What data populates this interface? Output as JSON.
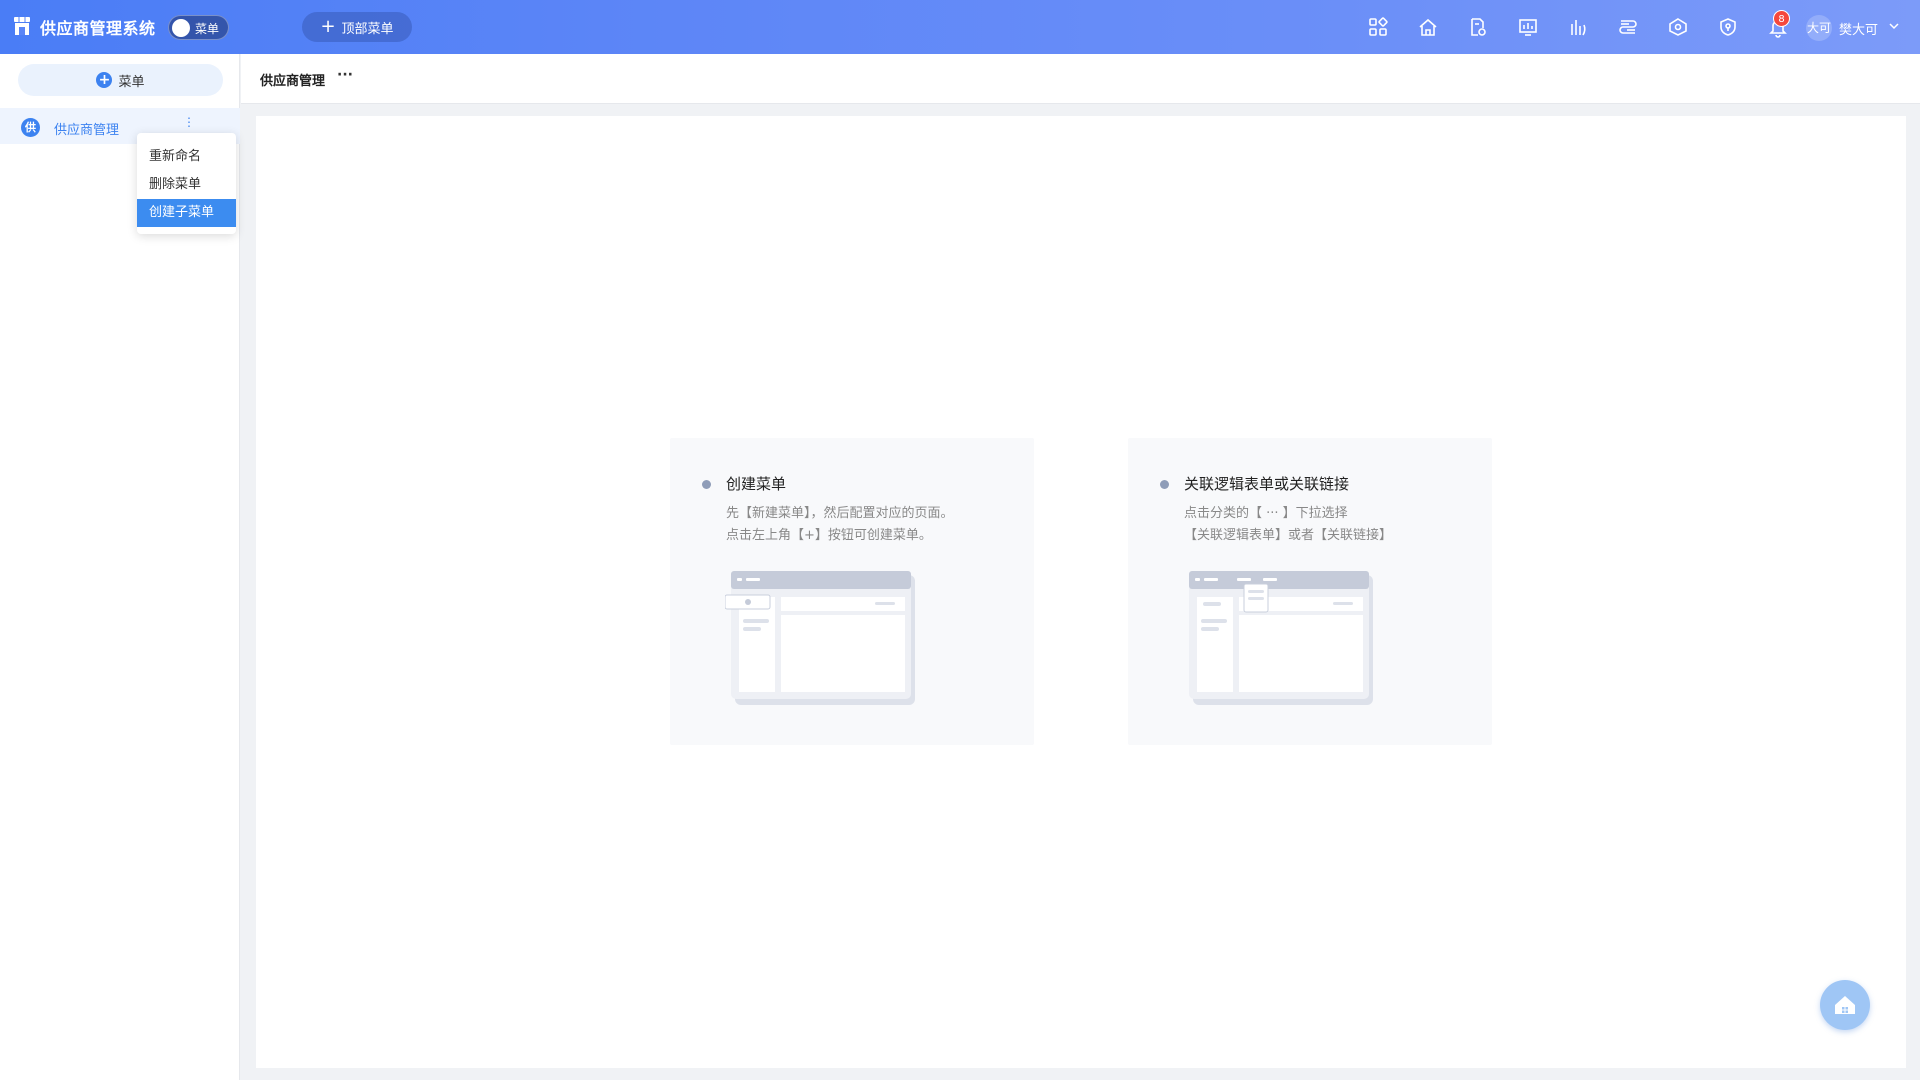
{
  "header": {
    "app_title": "供应商管理系统",
    "toggle_label": "菜单",
    "top_menu_button": "顶部菜单",
    "icons": [
      "apps-icon",
      "home-icon",
      "document-settings-icon",
      "dashboard-chart-icon",
      "bar-chart-icon",
      "flow-icon",
      "network-icon",
      "shield-icon",
      "bell-icon"
    ],
    "notification_count": "8",
    "user_avatar_text": "大可",
    "user_name": "樊大可"
  },
  "sidebar": {
    "add_button_label": "菜单",
    "items": [
      {
        "icon_text": "供",
        "label": "供应商管理",
        "more": "⋮"
      }
    ],
    "context_menu": {
      "items": [
        "重新命名",
        "删除菜单",
        "创建子菜单"
      ],
      "active_index": 2
    }
  },
  "breadcrumb": {
    "title": "供应商管理",
    "more": "···"
  },
  "main": {
    "cards": [
      {
        "title": "创建菜单",
        "line1": "先【新建菜单】，然后配置对应的页面。",
        "line2": "点击左上角【+】按钮可创建菜单。"
      },
      {
        "title": "关联逻辑表单或关联链接",
        "line1": "点击分类的【 ··· 】下拉选择",
        "line2": "【关联逻辑表单】或者【关联链接】"
      }
    ]
  },
  "colors": {
    "header_gradient_start": "#4a7df6",
    "header_gradient_end": "#7c9bf9",
    "accent": "#3c82f0",
    "badge": "#f5483c",
    "fab": "#9fc6f5"
  }
}
